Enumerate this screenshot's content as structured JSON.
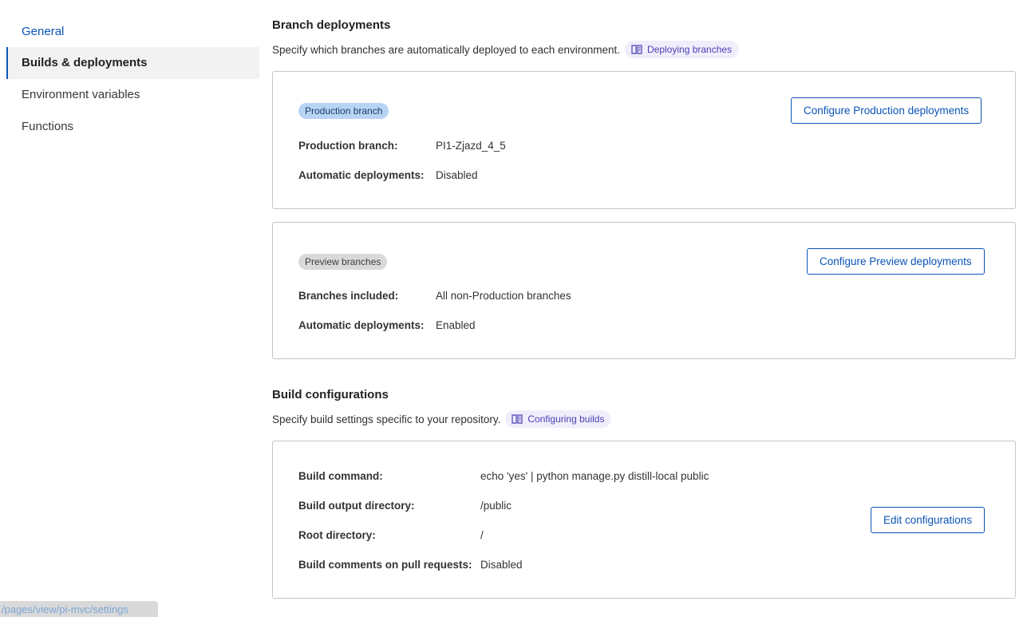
{
  "sidebar": {
    "items": [
      {
        "label": "General"
      },
      {
        "label": "Builds & deployments"
      },
      {
        "label": "Environment variables"
      },
      {
        "label": "Functions"
      }
    ]
  },
  "status_url": "/pages/view/pi-mvc/settings",
  "branch_deployments": {
    "title": "Branch deployments",
    "description": "Specify which branches are automatically deployed to each environment.",
    "doc_link": "Deploying branches",
    "production": {
      "badge": "Production branch",
      "button": "Configure Production deployments",
      "rows": [
        {
          "label": "Production branch:",
          "value": "PI1-Zjazd_4_5"
        },
        {
          "label": "Automatic deployments:",
          "value": "Disabled"
        }
      ]
    },
    "preview": {
      "badge": "Preview branches",
      "button": "Configure Preview deployments",
      "rows": [
        {
          "label": "Branches included:",
          "value": "All non-Production branches"
        },
        {
          "label": "Automatic deployments:",
          "value": "Enabled"
        }
      ]
    }
  },
  "build_configurations": {
    "title": "Build configurations",
    "description": "Specify build settings specific to your repository.",
    "doc_link": "Configuring builds",
    "button": "Edit configurations",
    "rows": [
      {
        "label": "Build command:",
        "value": "echo 'yes' | python manage.py distill-local public"
      },
      {
        "label": "Build output directory:",
        "value": "/public"
      },
      {
        "label": "Root directory:",
        "value": "/"
      },
      {
        "label": "Build comments on pull requests:",
        "value": "Disabled"
      }
    ]
  }
}
